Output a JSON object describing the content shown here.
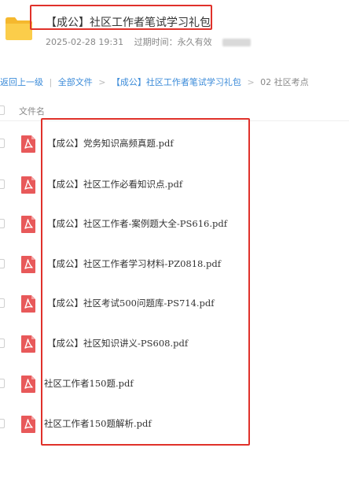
{
  "share": {
    "title": "【成公】社区工作者笔试学习礼包",
    "date": "2025-02-28 19:31",
    "expiry": "过期时间：永久有效"
  },
  "breadcrumb": {
    "back": "返回上一级",
    "divider": "|",
    "all_files": "全部文件",
    "folder": "【成公】社区工作者笔试学习礼包",
    "current": "02 社区考点"
  },
  "table": {
    "column_name": "文件名"
  },
  "files": [
    {
      "name": "【成公】党务知识高频真题.pdf"
    },
    {
      "name": "【成公】社区工作必看知识点.pdf"
    },
    {
      "name": "【成公】社区工作者-案例题大全-PS616.pdf"
    },
    {
      "name": "【成公】社区工作者学习材料-PZ0818.pdf"
    },
    {
      "name": "【成公】社区考试500问题库-PS714.pdf"
    },
    {
      "name": "【成公】社区知识讲义-PS608.pdf"
    },
    {
      "name": "社区工作者150题.pdf"
    },
    {
      "name": "社区工作者150题解析.pdf"
    }
  ],
  "icons": {
    "folder": "folder-icon",
    "file": "pdf-icon"
  },
  "colors": {
    "highlight": "#e0312a",
    "link": "#3b8bd9",
    "pdf": "#e8595a",
    "folder": "#f9c23c"
  }
}
